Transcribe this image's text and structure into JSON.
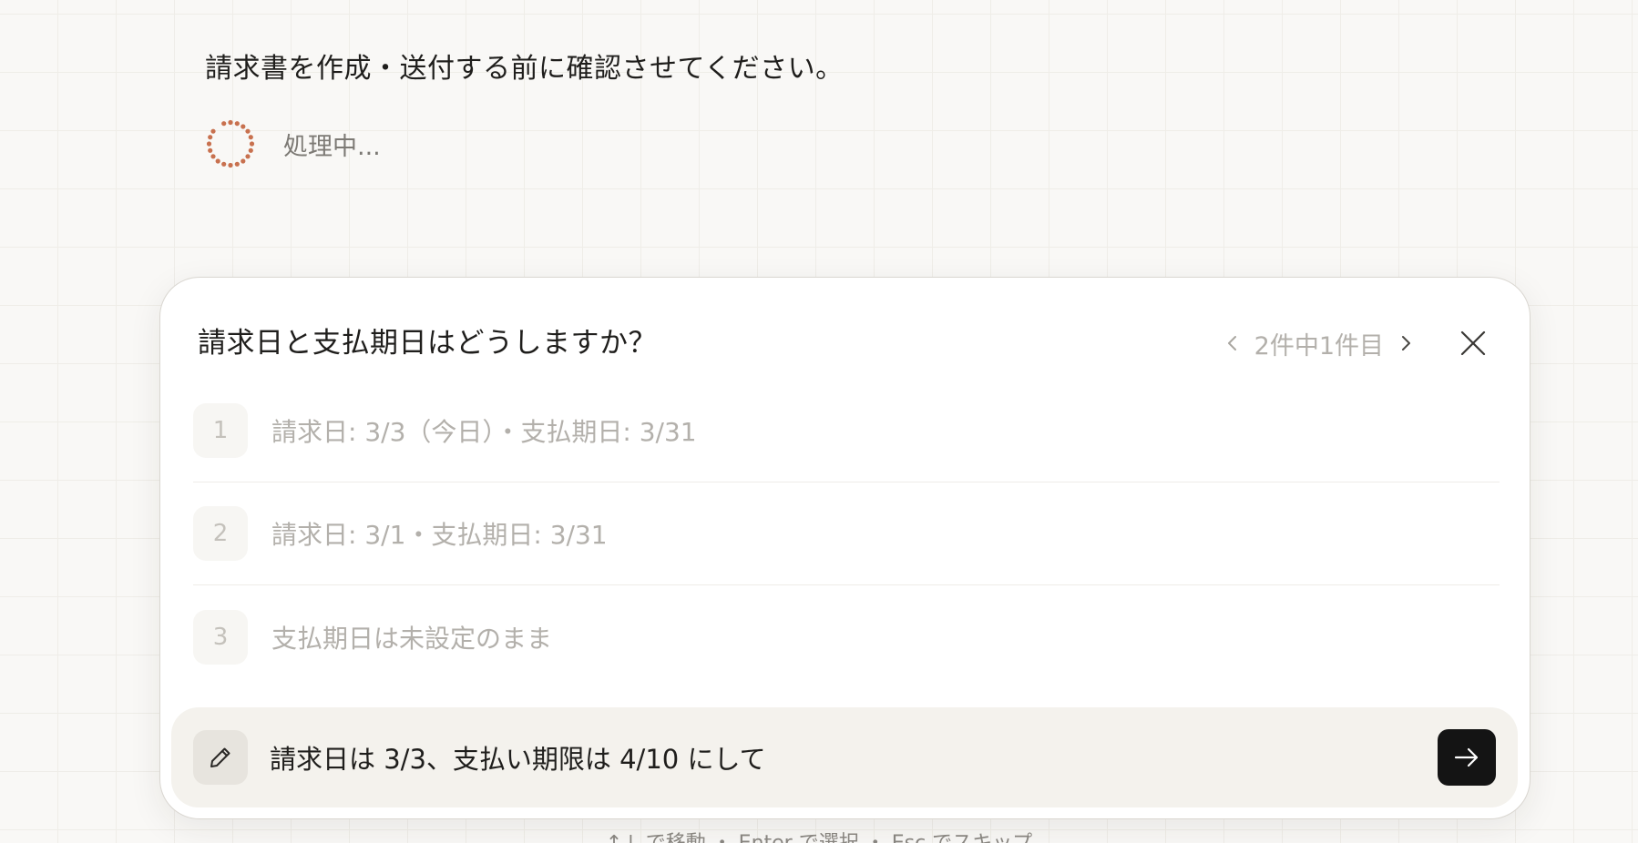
{
  "conversation": {
    "user_message": "請求書を作成・送付する前に確認させてください。",
    "status_text": "処理中..."
  },
  "question": {
    "title": "請求日と支払期日はどうしますか？",
    "pager_text": "2件中1件目",
    "options": [
      {
        "number": "1",
        "label": "請求日: 3/3（今日）・支払期日: 3/31"
      },
      {
        "number": "2",
        "label": "請求日: 3/1・支払期日: 3/31"
      },
      {
        "number": "3",
        "label": "支払期日は未設定のまま"
      }
    ],
    "input_value": "請求日は 3/3、支払い期限は 4/10 にして"
  },
  "footer": {
    "hint_text": "↑↓ で移動 ・ Enter で選択 ・ Esc でスキップ"
  },
  "icons": {
    "spinner": "spinner-icon",
    "prev": "chevron-left-icon",
    "next": "chevron-right-icon",
    "close": "close-icon",
    "edit": "pencil-icon",
    "send": "arrow-right-icon"
  },
  "colors": {
    "spinner": "#c8714f",
    "send_button": "#141414",
    "input_background": "#f4f2ed"
  }
}
